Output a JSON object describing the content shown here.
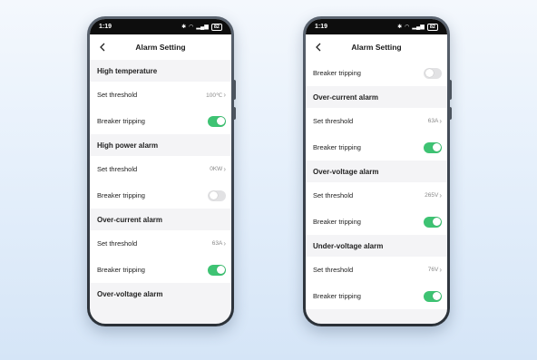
{
  "status_bar": {
    "time": "1:19",
    "battery": "82"
  },
  "colors": {
    "toggle_on": "#3ec373",
    "toggle_off": "#e2e2e4",
    "status_bar_bg": "#0d0d0d"
  },
  "phones": [
    {
      "title": "Alarm Setting",
      "back_icon": "chevron-left-icon",
      "content": [
        {
          "kind": "header",
          "label": "High temperature"
        },
        {
          "kind": "value",
          "label": "Set threshold",
          "value": "100℃"
        },
        {
          "kind": "toggle",
          "label": "Breaker tripping",
          "on": true
        },
        {
          "kind": "header",
          "label": "High power alarm"
        },
        {
          "kind": "value",
          "label": "Set threshold",
          "value": "0KW"
        },
        {
          "kind": "toggle",
          "label": "Breaker tripping",
          "on": false
        },
        {
          "kind": "header",
          "label": "Over-current alarm"
        },
        {
          "kind": "value",
          "label": "Set threshold",
          "value": "63A"
        },
        {
          "kind": "toggle",
          "label": "Breaker tripping",
          "on": true
        },
        {
          "kind": "header",
          "label": "Over-voltage alarm"
        }
      ]
    },
    {
      "title": "Alarm Setting",
      "back_icon": "chevron-left-icon",
      "content": [
        {
          "kind": "toggle",
          "label": "Breaker tripping",
          "on": false
        },
        {
          "kind": "header",
          "label": "Over-current alarm"
        },
        {
          "kind": "value",
          "label": "Set threshold",
          "value": "63A"
        },
        {
          "kind": "toggle",
          "label": "Breaker tripping",
          "on": true
        },
        {
          "kind": "header",
          "label": "Over-voltage alarm"
        },
        {
          "kind": "value",
          "label": "Set threshold",
          "value": "265V"
        },
        {
          "kind": "toggle",
          "label": "Breaker tripping",
          "on": true
        },
        {
          "kind": "header",
          "label": "Under-voltage alarm"
        },
        {
          "kind": "value",
          "label": "Set threshold",
          "value": "76V"
        },
        {
          "kind": "toggle",
          "label": "Breaker tripping",
          "on": true
        }
      ]
    }
  ]
}
